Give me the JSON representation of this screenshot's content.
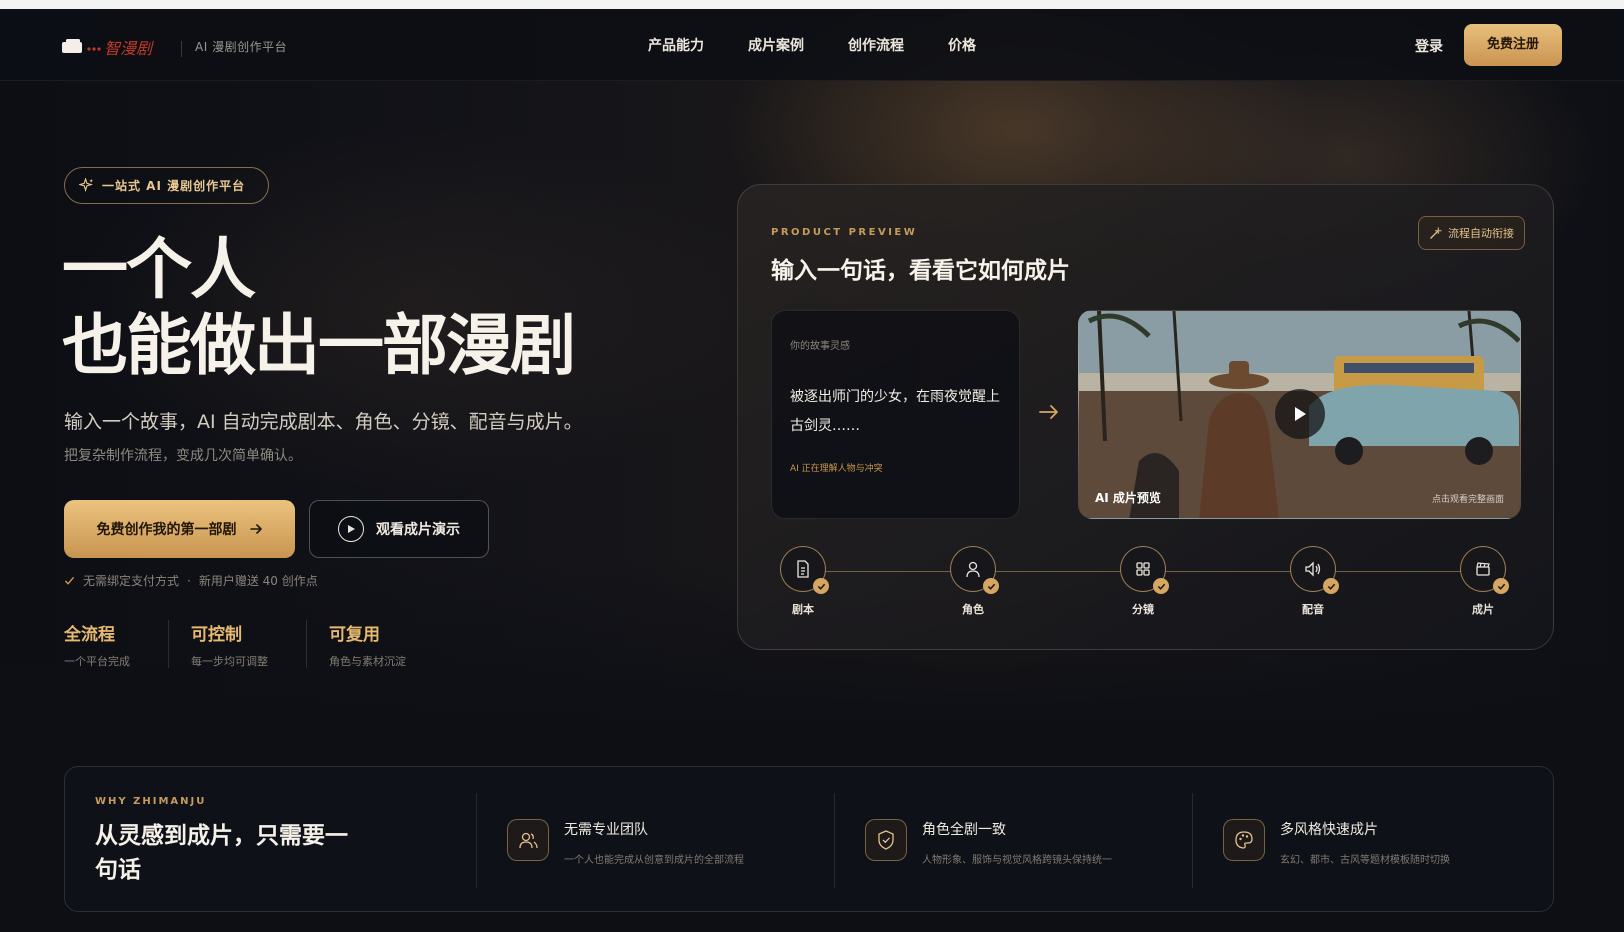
{
  "nav": {
    "brand_logo_text": "智漫剧",
    "brand_sub": "AI 漫剧创作平台",
    "links": [
      "产品能力",
      "成片案例",
      "创作流程",
      "价格"
    ],
    "login": "登录",
    "signup": "免费注册"
  },
  "hero": {
    "badge": "一站式 AI 漫剧创作平台",
    "title_line1": "一个人",
    "title_line2": "也能做出一部漫剧",
    "desc": "输入一个故事，AI 自动完成剧本、角色、分镜、配音与成片。",
    "sub": "把复杂制作流程，变成几次简单确认。",
    "cta_primary": "免费创作我的第一部剧",
    "cta_secondary": "观看成片演示",
    "note_1": "无需绑定支付方式",
    "note_sep": "·",
    "note_2": "新用户赠送 40 创作点",
    "features": [
      {
        "title": "全流程",
        "sub": "一个平台完成"
      },
      {
        "title": "可控制",
        "sub": "每一步均可调整"
      },
      {
        "title": "可复用",
        "sub": "角色与素材沉淀"
      }
    ]
  },
  "preview": {
    "eyebrow": "PRODUCT PREVIEW",
    "title": "输入一句话，看看它如何成片",
    "tag": "流程自动衔接",
    "story_label": "你的故事灵感",
    "story_text": "被逐出师门的少女，在雨夜觉醒上古剑灵……",
    "story_status": "AI 正在理解人物与冲突",
    "video_label": "AI 成片预览",
    "video_hint": "点击观看完整画面",
    "steps": [
      "剧本",
      "角色",
      "分镜",
      "配音",
      "成片"
    ]
  },
  "why": {
    "eyebrow": "WHY ZHIMANJU",
    "title": "从灵感到成片，只需要一句话",
    "items": [
      {
        "title": "无需专业团队",
        "desc": "一个人也能完成从创意到成片的全部流程",
        "icon": "users-icon"
      },
      {
        "title": "角色全剧一致",
        "desc": "人物形象、服饰与视觉风格跨镜头保持统一",
        "icon": "shield-icon"
      },
      {
        "title": "多风格快速成片",
        "desc": "玄幻、都市、古风等题材模板随时切换",
        "icon": "palette-icon"
      }
    ]
  },
  "colors": {
    "accent": "#d4a662",
    "background": "#0d0f15"
  }
}
